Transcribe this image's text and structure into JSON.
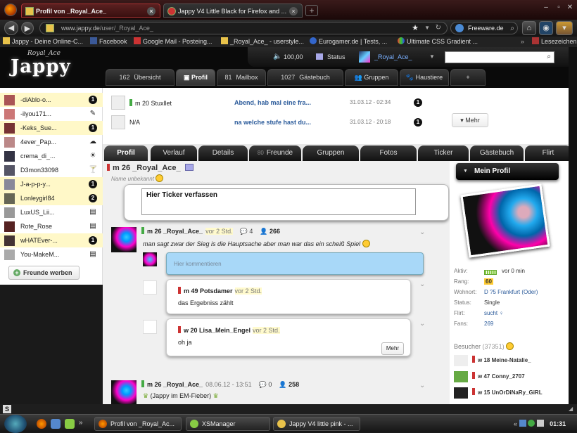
{
  "browser": {
    "tabs": [
      {
        "label": "Profil von _Royal_Ace_"
      },
      {
        "label": "Jappy V4 Little Black for Firefox and ..."
      }
    ],
    "url_host": "www.jappy.de",
    "url_path": "/user/_Royal_Ace_",
    "search_engine": "Freeware.de",
    "bookmarks": [
      "Jappy - Deine Online-C...",
      "Facebook",
      "Google Mail - Posteing...",
      "_Royal_Ace_ - userstyle...",
      "Eurogamer.de | Tests, ...",
      "Ultimate CSS Gradient ...",
      "Lesezeichen"
    ]
  },
  "site": {
    "logo_top": "Royal_Ace",
    "logo_main": "Jappy",
    "points": "100,00",
    "status_label": "Status",
    "username": "_Royal_Ace_",
    "nav": [
      {
        "count": "162",
        "label": "Übersicht"
      },
      {
        "count": "",
        "label": "Profil"
      },
      {
        "count": "81",
        "label": "Mailbox"
      },
      {
        "count": "1027",
        "label": "Gästebuch"
      },
      {
        "count": "",
        "label": "Gruppen"
      },
      {
        "count": "",
        "label": "Haustiere"
      },
      {
        "count": "",
        "label": "+"
      }
    ]
  },
  "friends": [
    {
      "name": "-diAblo-o...",
      "badge": "1",
      "highlight": true
    },
    {
      "name": "-ilyou171...",
      "badge": "",
      "highlight": false
    },
    {
      "name": "-Keks_Sue...",
      "badge": "1",
      "highlight": true
    },
    {
      "name": "4ever_Pap...",
      "badge": "",
      "highlight": false
    },
    {
      "name": "crema_di_...",
      "badge": "",
      "highlight": false
    },
    {
      "name": "D3mon33098",
      "badge": "",
      "highlight": false
    },
    {
      "name": "J-a-p-p-y...",
      "badge": "1",
      "highlight": true
    },
    {
      "name": "Lonleygirl84",
      "badge": "2",
      "highlight": true
    },
    {
      "name": "LuxUS_Lii...",
      "badge": "",
      "highlight": false
    },
    {
      "name": "Rote_Rose",
      "badge": "",
      "highlight": false
    },
    {
      "name": "wHATEver-...",
      "badge": "1",
      "highlight": true
    },
    {
      "name": "You-MakeM...",
      "badge": "",
      "highlight": false
    }
  ],
  "invite_label": "Freunde werben",
  "mails": [
    {
      "who": "m 20 Stuxllet",
      "msg": "Abend, hab mal eine fra...",
      "date": "31.03.12 - 02:34",
      "badge": "1"
    },
    {
      "who": "N/A",
      "msg": "na welche stufe hast du...",
      "date": "31.03.12 - 20:18",
      "badge": "1"
    }
  ],
  "mail_more": "Mehr",
  "profile_tabs": [
    {
      "count": "",
      "label": "Profil"
    },
    {
      "count": "",
      "label": "Verlauf"
    },
    {
      "count": "",
      "label": "Details"
    },
    {
      "count": "80",
      "label": "Freunde"
    },
    {
      "count": "",
      "label": "Gruppen"
    },
    {
      "count": "",
      "label": "Fotos"
    },
    {
      "count": "",
      "label": "Ticker"
    },
    {
      "count": "",
      "label": "Gästebuch"
    },
    {
      "count": "",
      "label": "Flirt"
    }
  ],
  "profile": {
    "name": "m 26 _Royal_Ace_",
    "name_sub": "Name unbekannt",
    "ticker_placeholder": "Hier Ticker verfassen"
  },
  "posts": [
    {
      "author": "m 26 _Royal_Ace_",
      "time": "vor 2 Std.",
      "comments": "4",
      "views": "266",
      "text": "man sagt zwar der Sieg is die Hauptsache aber man war das ein scheiß Spiel"
    },
    {
      "author": "m 26 _Royal_Ace_",
      "time": "08.06.12 - 13:51",
      "comments": "0",
      "views": "258",
      "text": "(Jappy im EM-Fieber)"
    }
  ],
  "comment_placeholder": "Hier kommentieren",
  "comments": [
    {
      "author": "m 49 Potsdamer",
      "time": "vor 2 Std.",
      "text": "das Ergebniss zählt"
    },
    {
      "author": "w 20 Lisa_Mein_Engel",
      "time": "vor 2 Std.",
      "text": "oh ja"
    }
  ],
  "comments_more": "Mehr",
  "right": {
    "title": "Mein Profil",
    "info": [
      {
        "k": "Aktiv:",
        "v": "vor 0 min"
      },
      {
        "k": "Rang:",
        "v": "60"
      },
      {
        "k": "Wohnort:",
        "v": "D ?5 Frankfurt (Oder)"
      },
      {
        "k": "Status:",
        "v": "Single"
      },
      {
        "k": "Flirt:",
        "v": "sucht ♀"
      },
      {
        "k": "Fans:",
        "v": "269"
      }
    ],
    "visitors_label": "Besucher",
    "visitors_count": "(37351)",
    "visitors": [
      {
        "name": "w 18 Meine-Natalie_"
      },
      {
        "name": "w 47 Conny_2707"
      },
      {
        "name": "w 15 UnOrDiNaRy_GiRL"
      }
    ]
  },
  "taskbar": {
    "items": [
      {
        "label": "Profil von _Royal_Ac..."
      },
      {
        "label": "XSManager"
      },
      {
        "label": "Jappy V4 little pink - ..."
      }
    ],
    "clock": "01:31"
  }
}
